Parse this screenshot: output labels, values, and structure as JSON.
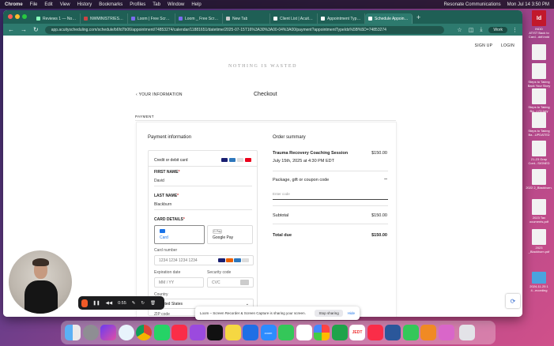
{
  "menubar": {
    "items": [
      "Chrome",
      "File",
      "Edit",
      "View",
      "History",
      "Bookmarks",
      "Profiles",
      "Tab",
      "Window",
      "Help"
    ],
    "right": [
      "Resonate Communications",
      "Mon Jul 14  3:50 PM"
    ]
  },
  "browser": {
    "tabs": [
      "Reviews 1 — Nothing",
      "NWMINISTRIES Email",
      "Loom | Free Screen R",
      "Loom _ Free Screen R",
      "New Tab",
      "Client List | Acuity Sc",
      "Appointment Types |",
      "Schedule Appointme"
    ],
    "active_tab_index": 7,
    "url": "app.acuityscheduling.com/schedule/b6fd7b06/appointment/74853274/calendar/11881651/datetime/2025-07-15T16%3A30%3A00-04%3A00/payment?appointmentTypeIds%5B%5D=74853274",
    "profile": "Work"
  },
  "page": {
    "top_links": [
      "SIGN UP",
      "LOGIN"
    ],
    "logo": "NOTHING IS WASTED",
    "back_link": "YOUR INFORMATION",
    "title": "Checkout",
    "payment_label": "PAYMENT",
    "payment_info_title": "Payment information",
    "credit_card_title": "Credit or debit card",
    "first_name_label": "FIRST NAME",
    "first_name_value": "David",
    "last_name_label": "LAST NAME",
    "last_name_value": "Blackburn",
    "card_details_label": "CARD DETAILS",
    "pay_option_card": "Card",
    "pay_option_gpay": "Google Pay",
    "gpay_badge": "G Pay",
    "card_number_label": "Card number",
    "card_number_placeholder": "1234 1234 1234 1234",
    "expiration_label": "Expiration date",
    "expiration_placeholder": "MM / YY",
    "security_label": "Security code",
    "security_placeholder": "CVC",
    "country_label": "Country",
    "country_value": "United States",
    "zip_label": "ZIP code",
    "order_summary_title": "Order summary",
    "service_name": "Trauma Recovery Coaching Session",
    "service_price": "$150.00",
    "service_datetime": "July 15th, 2025 at 4:30 PM EDT",
    "coupon_label": "Package, gift or coupon code",
    "coupon_placeholder": "Enter code",
    "subtotal_label": "Subtotal",
    "subtotal_value": "$150.00",
    "total_label": "Total due",
    "total_value": "$150.00"
  },
  "loom": {
    "timer": "0:55",
    "sharing_text": "Loom – Screen Recorder & Screen Capture is sharing your screen.",
    "stop_button": "Stop sharing",
    "hide_button": "Hide"
  },
  "dock": {
    "apps": [
      "finder",
      "system-settings",
      "siri",
      "safari",
      "chrome",
      "whatsapp",
      "music",
      "podcasts",
      "tv",
      "notes",
      "keynote",
      "zoom",
      "messages",
      "slack",
      "photos",
      "numbers",
      "calendar",
      "news",
      "word",
      "facetime",
      "books",
      "more"
    ],
    "date_badge": "JEDT",
    "app_label_zoom": "zoom"
  },
  "desktop": {
    "files": [
      "ATIST Back to Card...ddf.indd",
      "",
      "Steps to Taking Back Your Story",
      "Steps to Taking Ba...r (1).key",
      "Steps to Taking Ba...UPDATED",
      "21-23 Grap Cont...SIGNED",
      "2022 2_Blackburn.",
      "2023 Tax ocuments.pdf",
      "2023 _Blackburn.pdf",
      "2024-11-25 1 4...ecording"
    ],
    "indesign_label": "Id",
    "indesign_caption": "INDD"
  },
  "colors": {
    "tab_bar": "#1f5f55",
    "address_bar": "#2d7a6e",
    "loom_record": "#f05a28",
    "link_blue": "#1a73e8"
  }
}
